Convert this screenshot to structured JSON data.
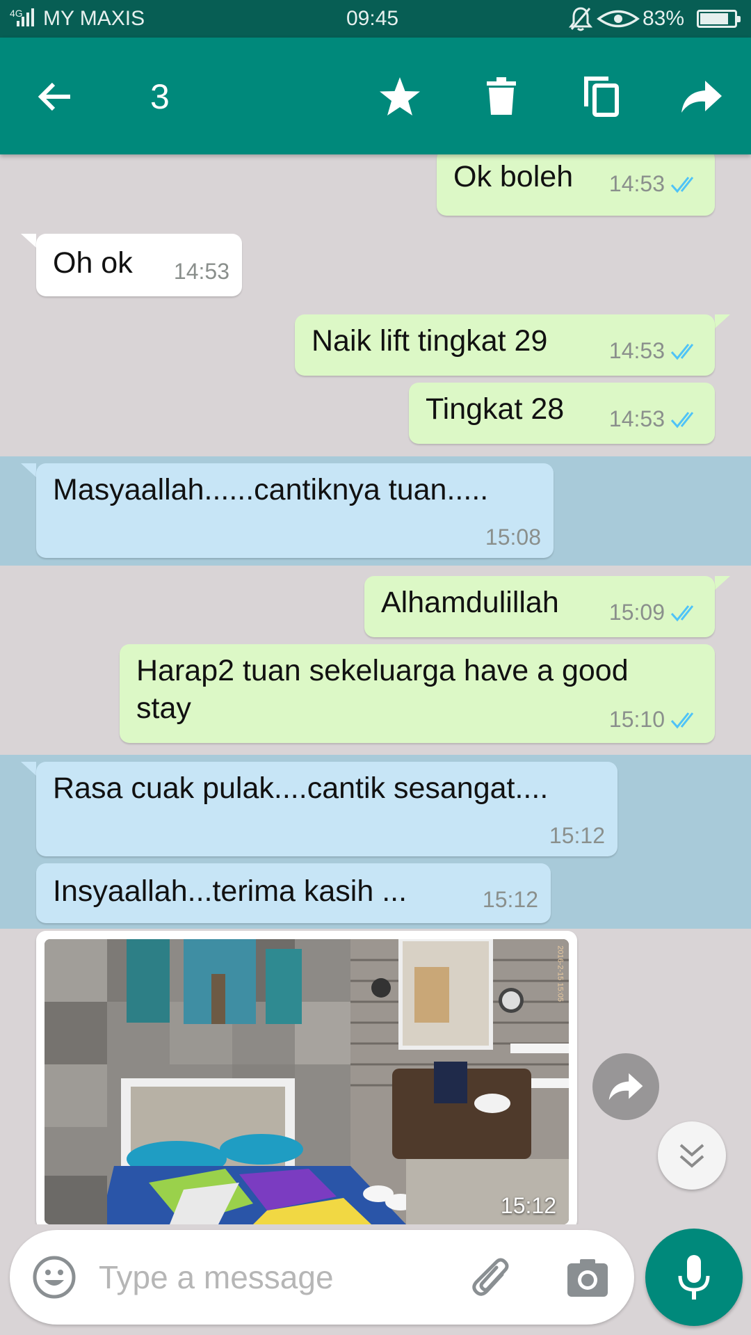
{
  "status_bar": {
    "network": "4G",
    "carrier": "MY MAXIS",
    "time": "09:45",
    "battery": "83%",
    "battery_level": 0.83
  },
  "action_bar": {
    "selected_count": "3"
  },
  "messages": [
    {
      "direction": "out",
      "text": "Ok boleh",
      "time": "14:53",
      "read": true,
      "selected": false
    },
    {
      "direction": "in",
      "text": "Oh ok",
      "time": "14:53",
      "selected": false
    },
    {
      "direction": "out",
      "text": "Naik lift tingkat 29",
      "time": "14:53",
      "read": true,
      "selected": false
    },
    {
      "direction": "out",
      "text": "Tingkat 28",
      "time": "14:53",
      "read": true,
      "selected": false
    },
    {
      "direction": "in",
      "text": "Masyaallah......cantiknya tuan.....",
      "time": "15:08",
      "selected": true
    },
    {
      "direction": "out",
      "text": "Alhamdulillah",
      "time": "15:09",
      "read": true,
      "selected": false
    },
    {
      "direction": "out",
      "text_line1": "Harap2 tuan sekeluarga have a good",
      "text_line2": "stay",
      "time": "15:10",
      "read": true,
      "selected": false
    },
    {
      "direction": "in",
      "text": "Rasa cuak pulak....cantik sesangat....",
      "time": "15:12",
      "selected": true
    },
    {
      "direction": "in",
      "text": "Insyaallah...terima kasih ...",
      "time": "15:12",
      "selected": true
    }
  ],
  "photo_message": {
    "time": "15:12",
    "photo_stamp": "2016-2-15 15:05"
  },
  "composer": {
    "placeholder": "Type a message"
  },
  "colors": {
    "status_bar": "#075e54",
    "action_bar": "#00897b",
    "outgoing_bubble": "#dcf8c6",
    "incoming_bubble": "#ffffff",
    "selected_band": "#a8cad9",
    "read_ticks": "#4fc3f7"
  }
}
